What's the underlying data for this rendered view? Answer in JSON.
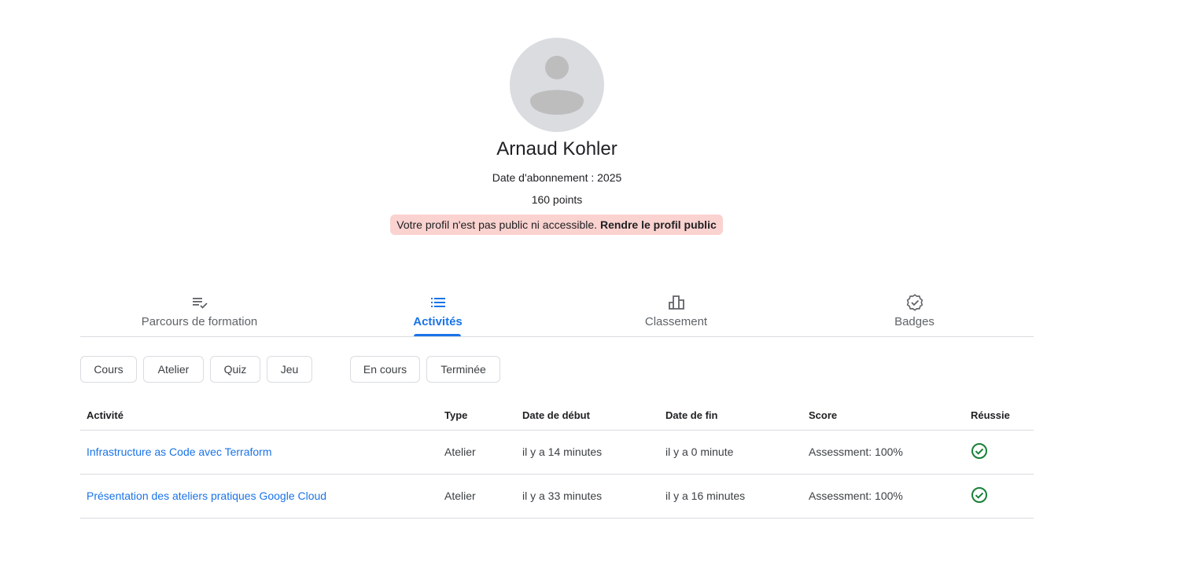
{
  "profile": {
    "name": "Arnaud Kohler",
    "subscription_date": "Date d'abonnement : 2025",
    "points": "160 points",
    "notice_text": "Votre profil n'est pas public ni accessible.",
    "notice_link": "Rendre le profil public",
    "avatar_icon": "person-icon"
  },
  "tabs": [
    {
      "label": "Parcours de formation",
      "icon": "playlist-check-icon",
      "active": false
    },
    {
      "label": "Activités",
      "icon": "list-icon",
      "active": true
    },
    {
      "label": "Classement",
      "icon": "leaderboard-icon",
      "active": false
    },
    {
      "label": "Badges",
      "icon": "verified-badge-icon",
      "active": false
    }
  ],
  "filters": {
    "type": [
      "Cours",
      "Atelier",
      "Quiz",
      "Jeu"
    ],
    "status": [
      "En cours",
      "Terminée"
    ]
  },
  "table": {
    "columns": [
      "Activité",
      "Type",
      "Date de début",
      "Date de fin",
      "Score",
      "Réussie"
    ],
    "rows": [
      {
        "activity": "Infrastructure as Code avec Terraform",
        "type": "Atelier",
        "start": "il y a 14 minutes",
        "end": "il y a 0 minute",
        "score": "Assessment: 100%",
        "passed_icon": "check-circle-icon"
      },
      {
        "activity": "Présentation des ateliers pratiques Google Cloud",
        "type": "Atelier",
        "start": "il y a 33 minutes",
        "end": "il y a 16 minutes",
        "score": "Assessment: 100%",
        "passed_icon": "check-circle-icon"
      }
    ]
  },
  "colors": {
    "accent": "#1a73e8",
    "notice_bg": "#fad2cf",
    "success": "#188038",
    "border": "#dadce0"
  }
}
